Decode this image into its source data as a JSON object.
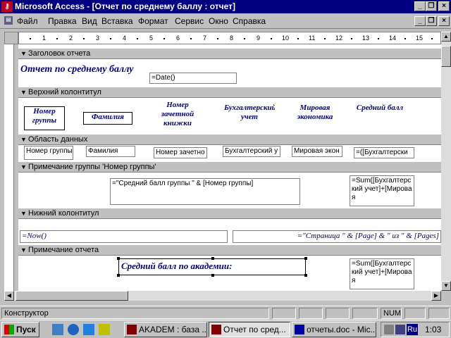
{
  "window": {
    "title": "Microsoft Access - [Отчет по среднему баллу : отчет]",
    "icon": "access-key-icon",
    "controls": [
      "minimize-icon",
      "restore-icon",
      "close-icon"
    ]
  },
  "menu": {
    "items": [
      "Файл",
      "Правка",
      "Вид",
      "Вставка",
      "Формат",
      "Сервис",
      "Окно",
      "Справка"
    ]
  },
  "ruler": {
    "marks": [
      "1",
      "2",
      "3",
      "4",
      "5",
      "6",
      "7",
      "8",
      "9",
      "10",
      "11",
      "12",
      "13",
      "14",
      "15"
    ]
  },
  "sections": {
    "report_header": "Заголовок отчета",
    "page_header": "Верхний колонтитул",
    "detail": "Область данных",
    "group_footer": "Примечание группы 'Номер группы'",
    "page_footer": "Нижний колонтитул",
    "report_footer": "Примечание отчета"
  },
  "report_header": {
    "title_label": "Отчет по среднему баллу",
    "date_field": "=Date()"
  },
  "page_header": {
    "labels": [
      "Номер группы",
      "Фамилия",
      "Номер зачетной книжки",
      "Бухгалтерский учет",
      "Мировая экономика",
      "Средний балл"
    ]
  },
  "detail": {
    "fields": [
      "Номер группы",
      "Фамилия",
      "Номер зачетно",
      "Бухгалтерский у",
      "Мировая экон",
      "=([Бухгалтерски"
    ]
  },
  "group_footer": {
    "text_expr": "=\"Средний балл группы \" & [Номер группы]",
    "sum_expr": "=Sum([Бухгалтерский учет]+[Мировая"
  },
  "page_footer": {
    "now_expr": "=Now()",
    "page_expr": "=\"Страница \" & [Page] & \" из \" & [Pages]"
  },
  "report_footer": {
    "label": "Средний балл по академии:",
    "sum_expr": "=Sum([Бухгалтерский учет]+[Мировая"
  },
  "status": {
    "mode": "Конструктор",
    "num": "NUM"
  },
  "taskbar": {
    "start": "Пуск",
    "tasks": [
      "AKADEM : база ...",
      "Отчет по сред...",
      "отчеты.doc - Mic..."
    ],
    "lang": "Ru",
    "clock": "1:03"
  },
  "colors": {
    "title_bar": "#000080",
    "label_text": "#000080",
    "face": "#c0c0c0"
  }
}
